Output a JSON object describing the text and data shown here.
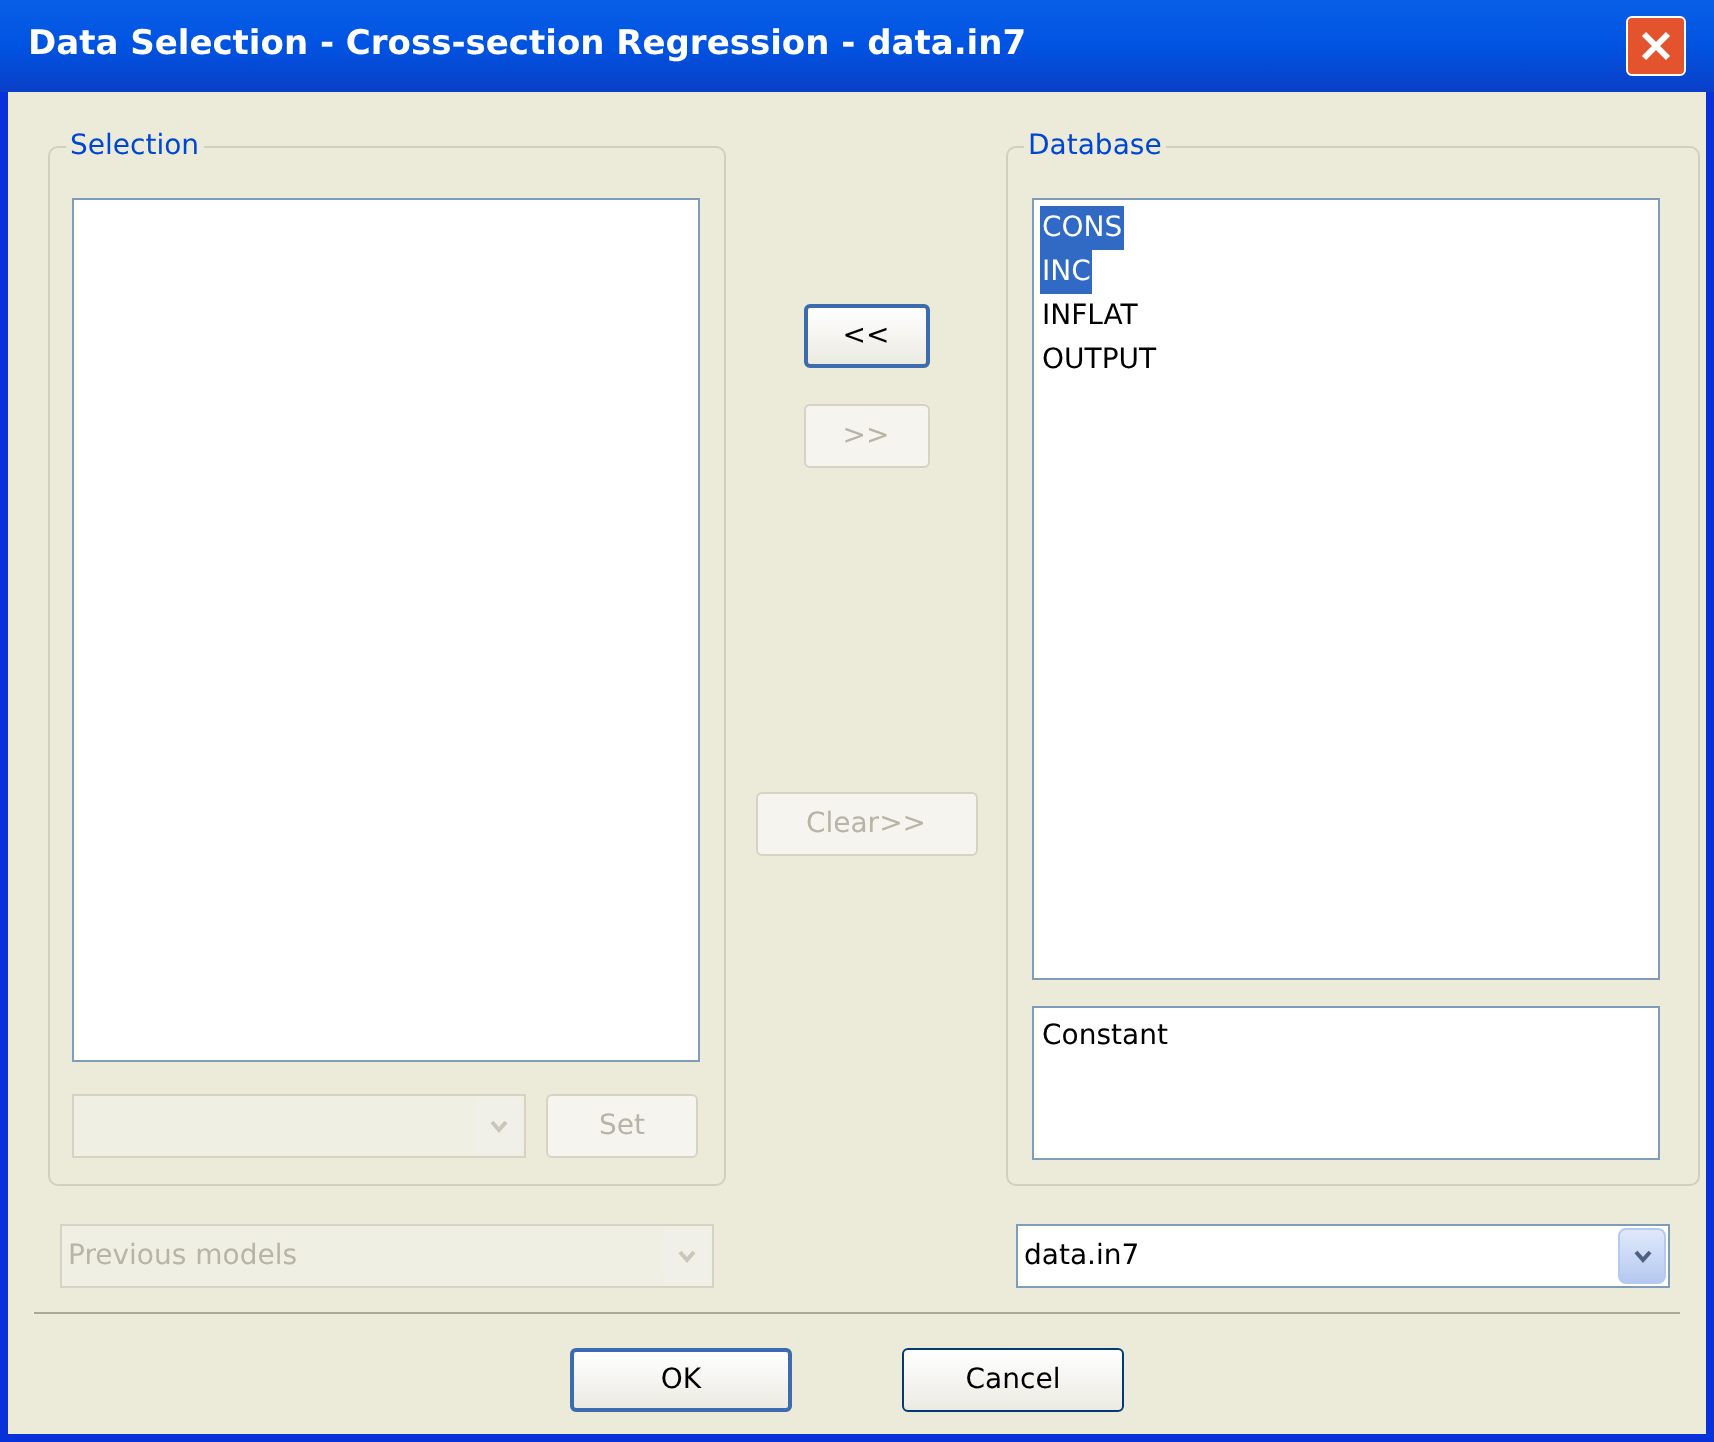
{
  "window": {
    "title": "Data Selection - Cross-section Regression - data.in7"
  },
  "selection": {
    "legend": "Selection",
    "set_button": {
      "label": "Set",
      "disabled": true
    }
  },
  "move_buttons": [
    {
      "label": "<<",
      "disabled": false,
      "focused": true
    },
    {
      "label": ">>",
      "disabled": true,
      "focused": false
    }
  ],
  "clear_button": {
    "label": "Clear>>",
    "disabled": true
  },
  "database": {
    "legend": "Database",
    "items": [
      {
        "label": "CONS",
        "selected": true
      },
      {
        "label": "INC",
        "selected": true
      },
      {
        "label": "INFLAT",
        "selected": false
      },
      {
        "label": "OUTPUT",
        "selected": false
      }
    ],
    "special": [
      "Constant"
    ]
  },
  "previous_models": {
    "placeholder": "Previous models",
    "disabled": true
  },
  "database_select": {
    "value": "data.in7",
    "disabled": false
  },
  "buttons": [
    {
      "label": "OK",
      "focused": true
    },
    {
      "label": "Cancel",
      "focused": false
    }
  ]
}
